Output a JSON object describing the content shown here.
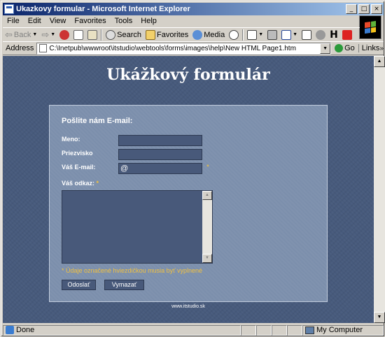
{
  "window": {
    "title": "Ukazkovy formular - Microsoft Internet Explorer",
    "controls": {
      "minimize": "_",
      "maximize": "□",
      "close": "×"
    }
  },
  "menubar": {
    "items": [
      "File",
      "Edit",
      "View",
      "Favorites",
      "Tools",
      "Help"
    ]
  },
  "toolbar": {
    "back_label": "Back",
    "search_label": "Search",
    "favorites_label": "Favorites",
    "media_label": "Media"
  },
  "address": {
    "label": "Address",
    "url": "C:\\Inetpub\\wwwroot\\itstudio\\webtools\\forms\\images\\help\\New HTML Page1.htm",
    "go_label": "Go",
    "links_label": "Links"
  },
  "page": {
    "title": "Ukážkový formulár",
    "form": {
      "heading": "Pošlite nám E-mail:",
      "fields": {
        "name_label": "Meno:",
        "name_value": "",
        "surname_label": "Priezvisko",
        "surname_value": "",
        "email_label": "Váš E-mail:",
        "email_value": "@",
        "message_label": "Váš odkaz:",
        "message_value": ""
      },
      "required_marker": "*",
      "required_note": "* Údaje označené hviezdičkou musia byť vyplnené",
      "submit_label": "Odoslať",
      "reset_label": "Vymazať"
    },
    "footer_link": "www.itstudio.sk"
  },
  "statusbar": {
    "status_text": "Done",
    "zone_text": "My Computer"
  }
}
